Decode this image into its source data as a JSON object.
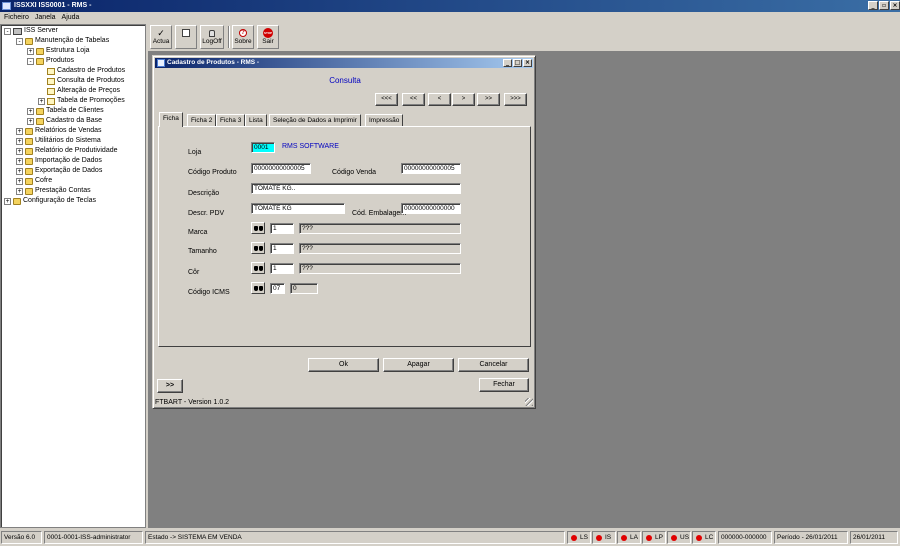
{
  "window": {
    "title": "ISSXXI ISS0001 - RMS -"
  },
  "menu": [
    "Ficheiro",
    "Janela",
    "Ajuda"
  ],
  "tree": [
    {
      "label": "ISS Server",
      "level": 0,
      "exp": "-",
      "icon": "computer-icon"
    },
    {
      "label": "Manutenção de Tabelas",
      "level": 1,
      "exp": "-",
      "icon": "folder-icon"
    },
    {
      "label": "Estrutura Loja",
      "level": 2,
      "exp": "+",
      "icon": "folder-icon"
    },
    {
      "label": "Produtos",
      "level": 2,
      "exp": "-",
      "icon": "folder-icon"
    },
    {
      "label": "Cadastro de Produtos",
      "level": 3,
      "exp": "",
      "icon": "form-icon"
    },
    {
      "label": "Consulta de Produtos",
      "level": 3,
      "exp": "",
      "icon": "form-icon"
    },
    {
      "label": "Alteração de Preços",
      "level": 3,
      "exp": "",
      "icon": "form-icon"
    },
    {
      "label": "Tabela de Promoções",
      "level": 3,
      "exp": "+",
      "icon": "form-icon"
    },
    {
      "label": "Tabela de Clientes",
      "level": 2,
      "exp": "+",
      "icon": "folder-icon"
    },
    {
      "label": "Cadastro da Base",
      "level": 2,
      "exp": "+",
      "icon": "folder-icon"
    },
    {
      "label": "Relatórios de Vendas",
      "level": 1,
      "exp": "+",
      "icon": "folder-icon"
    },
    {
      "label": "Utilitários do Sistema",
      "level": 1,
      "exp": "+",
      "icon": "folder-icon"
    },
    {
      "label": "Relatório de Produtividade",
      "level": 1,
      "exp": "+",
      "icon": "folder-icon"
    },
    {
      "label": "Importação de Dados",
      "level": 1,
      "exp": "+",
      "icon": "folder-icon"
    },
    {
      "label": "Exportação de Dados",
      "level": 1,
      "exp": "+",
      "icon": "folder-icon"
    },
    {
      "label": "Cofre",
      "level": 1,
      "exp": "+",
      "icon": "folder-icon"
    },
    {
      "label": "Prestação Contas",
      "level": 1,
      "exp": "+",
      "icon": "folder-icon"
    },
    {
      "label": "Configuração de Teclas",
      "level": 0,
      "exp": "+",
      "icon": "folder-icon"
    }
  ],
  "toolbar": {
    "actua": "Actua",
    "logoff": "LogOff",
    "sobre": "Sobre",
    "sair": "Sair",
    "sair_icon_text": "STOP"
  },
  "dialog": {
    "title": "Cadastro de Produtos - RMS -",
    "mode": "Consulta",
    "nav": [
      "<<<",
      "<<",
      "<",
      ">",
      ">>",
      ">>>"
    ],
    "tabs": [
      "Ficha",
      "Ficha 2",
      "Ficha 3",
      "Lista",
      "Seleção de Dados a Imprimir",
      "Impressão"
    ],
    "form": {
      "loja_label": "Loja",
      "loja_value": "0001",
      "loja_name": "RMS SOFTWARE",
      "codigo_produto_label": "Código Produto",
      "codigo_produto_value": "00000000000005",
      "codigo_venda_label": "Código Venda",
      "codigo_venda_value": "00000000000005",
      "descricao_label": "Descrição",
      "descricao_value": "TOMATE KG..",
      "descr_pdv_label": "Descr. PDV",
      "descr_pdv_value": "TOMATE KG",
      "cod_embalagem_label": "Cód. Embalagem",
      "cod_embalagem_value": "00000000000000",
      "marca_label": "Marca",
      "marca_value": "1",
      "marca_desc": "???",
      "tamanho_label": "Tamanho",
      "tamanho_value": "1",
      "tamanho_desc": "???",
      "cor_label": "Côr",
      "cor_value": "1",
      "cor_desc": "???",
      "icms_label": "Código ICMS",
      "icms_value": "07",
      "icms_desc": "0"
    },
    "buttons": {
      "ok": "Ok",
      "apagar": "Apagar",
      "cancelar": "Cancelar",
      "fechar": "Fechar",
      "more": ">>"
    },
    "version": "FTBART - Version 1.0.2"
  },
  "status": {
    "versao": "Versão 6.0",
    "user": "0001-0001-ISS-administrator",
    "estado": "Estado -> SISTEMA EM VENDA",
    "leds": [
      "LS",
      "IS",
      "LA",
      "LP",
      "US",
      "LC"
    ],
    "code": "000000-000000",
    "periodo": "Período - 26/01/2011",
    "date": "26/01/2011"
  },
  "colors": {
    "titlebar": "#0a246a",
    "led": "#e00000",
    "highlight": "#00ffff",
    "link": "#0000c0"
  }
}
